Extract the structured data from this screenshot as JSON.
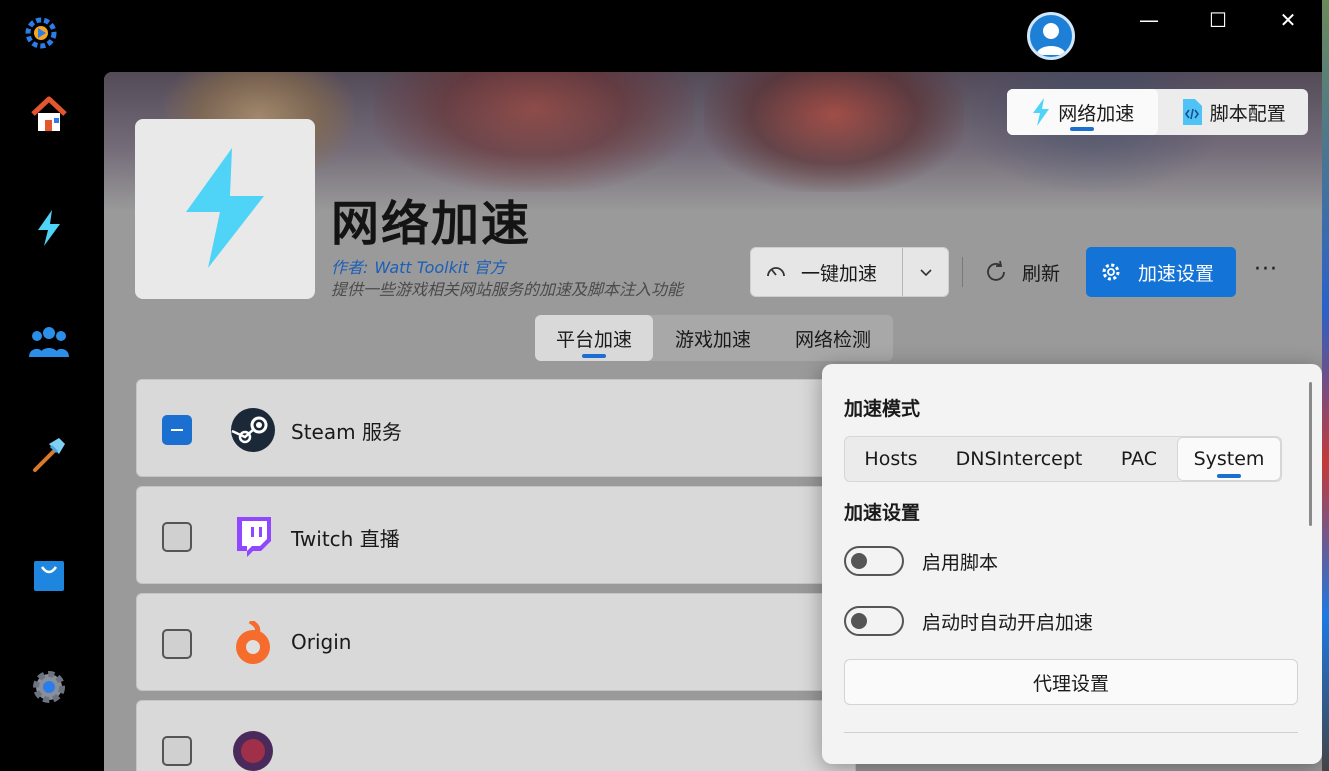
{
  "window": {
    "minimize_glyph": "—",
    "maximize_glyph": "☐",
    "close_glyph": "✕"
  },
  "nav": [
    {
      "icon": "home-icon"
    },
    {
      "icon": "lightning-icon"
    },
    {
      "icon": "users-icon"
    },
    {
      "icon": "tools-hammer-icon"
    },
    {
      "icon": "shop-bag-icon"
    },
    {
      "icon": "gear-icon"
    }
  ],
  "header_tabs": [
    {
      "label": "网络加速",
      "icon": "lightning-icon",
      "active": true
    },
    {
      "label": "脚本配置",
      "icon": "script-file-icon",
      "active": false
    }
  ],
  "plugin": {
    "title": "网络加速",
    "author_label": "作者:",
    "author_name": "Watt Toolkit 官方",
    "description": "提供一些游戏相关网站服务的加速及脚本注入功能"
  },
  "actions": {
    "one_key": "一键加速",
    "refresh": "刷新",
    "settings": "加速设置",
    "more": "···"
  },
  "sub_tabs": [
    {
      "label": "平台加速",
      "active": true
    },
    {
      "label": "游戏加速",
      "active": false
    },
    {
      "label": "网络检测",
      "active": false
    }
  ],
  "services": [
    {
      "name": "Steam 服务",
      "checked": "mixed",
      "icon": "steam-icon"
    },
    {
      "name": "Twitch 直播",
      "checked": "off",
      "icon": "twitch-icon"
    },
    {
      "name": "Origin",
      "checked": "off",
      "icon": "origin-icon"
    }
  ],
  "flyout": {
    "mode_heading": "加速模式",
    "modes": [
      {
        "label": "Hosts",
        "active": false
      },
      {
        "label": "DNSIntercept",
        "active": false
      },
      {
        "label": "PAC",
        "active": false
      },
      {
        "label": "System",
        "active": true
      }
    ],
    "settings_heading": "加速设置",
    "toggles": [
      {
        "label": "启用脚本",
        "on": false
      },
      {
        "label": "启动时自动开启加速",
        "on": false
      }
    ],
    "proxy_button": "代理设置"
  },
  "colors": {
    "accent": "#1473d6",
    "lightning": "#4fd4f7"
  }
}
